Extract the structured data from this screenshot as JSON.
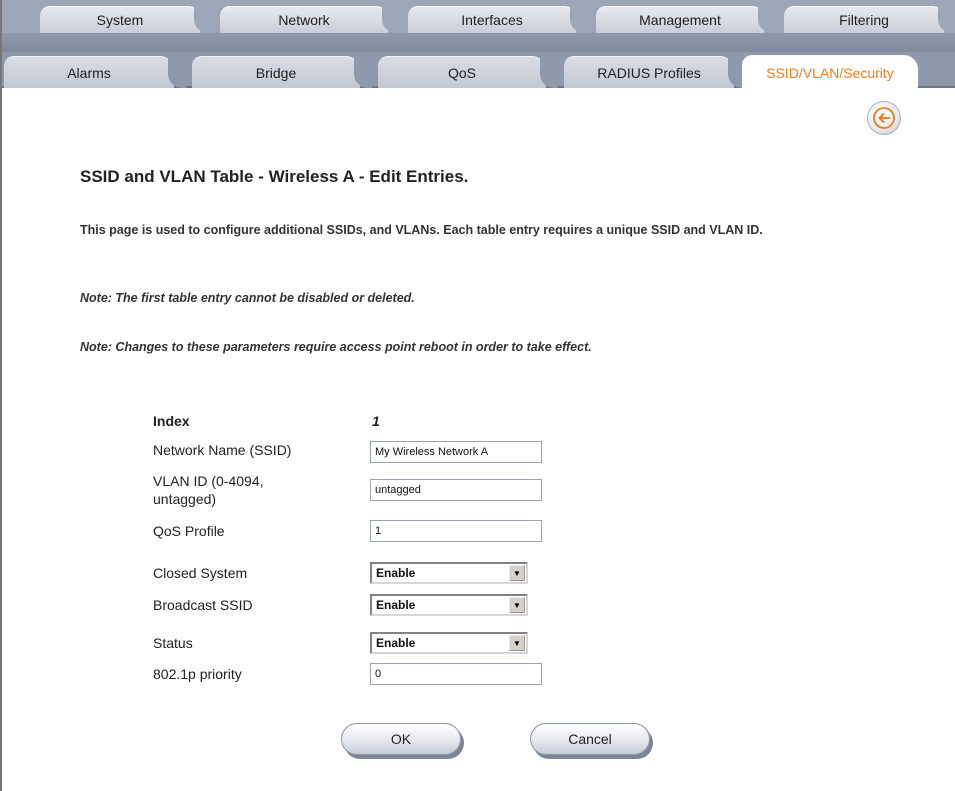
{
  "tabs_row1": [
    "System",
    "Network",
    "Interfaces",
    "Management",
    "Filtering"
  ],
  "tabs_row2": [
    "Alarms",
    "Bridge",
    "QoS",
    "RADIUS Profiles",
    "SSID/VLAN/Security"
  ],
  "active_tab": "SSID/VLAN/Security",
  "title": "SSID and VLAN Table - Wireless A - Edit Entries.",
  "description": "This page is used to configure additional SSIDs, and VLANs. Each table entry requires a unique SSID and VLAN ID.",
  "note1": "Note: The first table entry cannot be disabled or deleted.",
  "note2": "Note: Changes to these parameters require access point reboot in order to take effect.",
  "form": {
    "index_label": "Index",
    "index_value": "1",
    "ssid_label": "Network Name (SSID)",
    "ssid_value": "My Wireless Network A",
    "vlan_label": "VLAN ID (0-4094, untagged)",
    "vlan_value": "untagged",
    "qos_label": "QoS Profile",
    "qos_value": "1",
    "closed_label": "Closed System",
    "closed_value": "Enable",
    "broadcast_label": "Broadcast SSID",
    "broadcast_value": "Enable",
    "status_label": "Status",
    "status_value": "Enable",
    "priority_label": "802.1p priority",
    "priority_value": "0"
  },
  "buttons": {
    "ok": "OK",
    "cancel": "Cancel"
  },
  "colors": {
    "accent": "#f07c1e",
    "tab_bar": "#8e9aab"
  },
  "icons": {
    "back": "back-arrow-icon",
    "dropdown": "chevron-down-icon"
  }
}
